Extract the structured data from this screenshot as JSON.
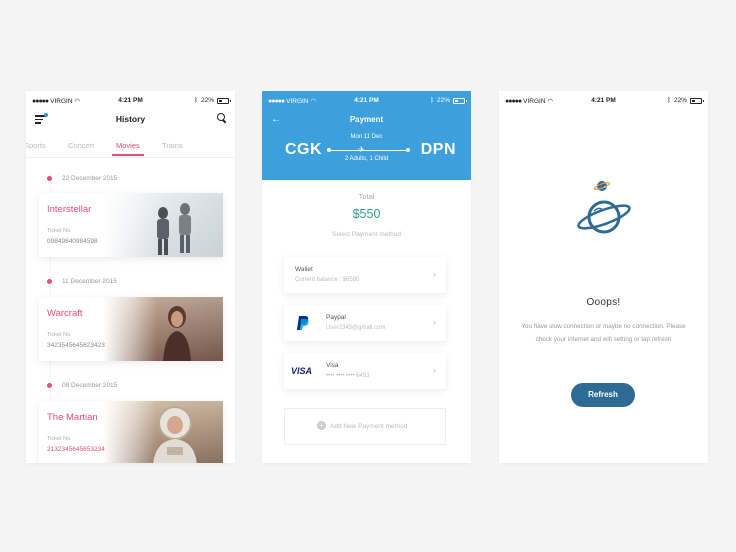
{
  "status": {
    "carrier": "VIRGIN",
    "time": "4:21 PM",
    "battery": "22%"
  },
  "history": {
    "title": "History",
    "tabs": [
      "Sports",
      "Concert",
      "Movies",
      "Trains"
    ],
    "active_tab": "Movies",
    "entries": [
      {
        "date": "22 December 2015",
        "movie": "Interstellar",
        "ticket_label": "Ticket No.",
        "ticket_no": "09849840984598"
      },
      {
        "date": "11 December 2015",
        "movie": "Warcraft",
        "ticket_label": "Ticket No.",
        "ticket_no": "3423545645623423"
      },
      {
        "date": "08 December 2015",
        "movie": "The Martian",
        "ticket_label": "Ticket No.",
        "ticket_no": "2132345645653234"
      }
    ]
  },
  "payment": {
    "title": "Payment",
    "from": "CGK",
    "to": "DPN",
    "date": "Mon 11 Dec",
    "passengers": "2 Adults, 1 Child",
    "total_label": "Total",
    "total": "$550",
    "select_label": "Select Payment method",
    "methods": [
      {
        "name": "Wallet",
        "detail": "Current balance : $6580"
      },
      {
        "name": "Paypal",
        "detail": "User2345@gmail.com"
      },
      {
        "name": "Visa",
        "detail": "•••• •••• •••• 6453"
      }
    ],
    "add_label": "Add New Payment method"
  },
  "offline": {
    "title": "Ooops!",
    "message": "You have slow connection or maybe no connection. Please check your internet and wifi setting or tap refresh",
    "button": "Refresh"
  },
  "colors": {
    "pink": "#e54e6e",
    "blue": "#3d9fdc",
    "green": "#2aa08a",
    "navy": "#2d6a94"
  }
}
